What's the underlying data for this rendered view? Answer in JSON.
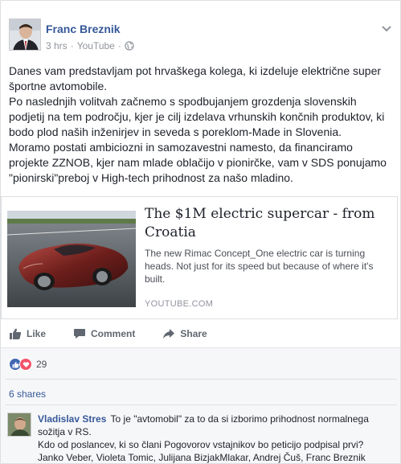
{
  "post": {
    "author": "Franc Breznik",
    "time": "3 hrs",
    "separator": "·",
    "source": "YouTube",
    "paragraphs": [
      "Danes vam predstavljam pot hrvaškega kolega, ki izdeluje električne super športne avtomobile.",
      "Po naslednjih volitvah začnemo s spodbujanjem grozdenja slovenskih podjetij na tem področju, kjer je cilj izdelava vrhunskih končnih produktov, ki bodo plod naših inženirjev in seveda s poreklom-Made in Slovenia.",
      "Moramo postati ambiciozni in samozavestni namesto, da financiramo projekte ZZNOB, kjer nam mlade oblačijo v pionirčke, vam v SDS ponujamo \"pionirski\"preboj v High-tech prihodnost za našo mladino."
    ]
  },
  "link": {
    "title": "The $1M electric supercar - from Croatia",
    "description": "The new Rimac Concept_One electric car is turning heads. Not just for its speed but because of where it's built.",
    "domain": "YOUTUBE.COM"
  },
  "actions": {
    "like": "Like",
    "comment": "Comment",
    "share": "Share"
  },
  "reactions": {
    "count": "29"
  },
  "shares": "6 shares",
  "comment": {
    "author": "Vladislav Stres",
    "text": "To je \"avtomobil\" za to da si izborimo prihodnost normalnega sožitja v RS.",
    "text2": "Kdo od poslancev, ki so člani Pogovorov vstajnikov bo peticijo podpisal prvi?",
    "text3": "Janko Veber, Violeta Tomic, Julijana BizjakMlakar, Andrej Čuš, Franc Breznik"
  },
  "colors": {
    "link_blue": "#365899",
    "like_blue": "#4267b2",
    "love_red": "#f25268",
    "gray_text": "#90949c"
  }
}
